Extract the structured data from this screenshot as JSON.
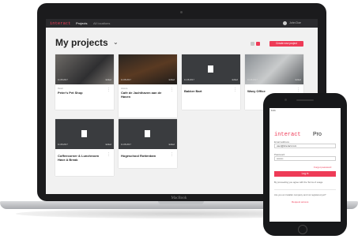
{
  "app": {
    "logo": "interact",
    "nav": [
      "Projects",
      "All locations"
    ],
    "user": "John Doe"
  },
  "page": {
    "title": "My projects",
    "create_button": "Create new project"
  },
  "projects": [
    {
      "name": "Peter's Pet Shop",
      "type": "Retail",
      "badge": "",
      "date": "11.08.2017",
      "edit": "Edited",
      "stats": "",
      "thumb": "photo"
    },
    {
      "name": "Café de Jachthaven aan de Haven",
      "type": "Horeca",
      "badge": "",
      "date": "11.08.2017",
      "edit": "Edited",
      "stats": "",
      "thumb": "photo"
    },
    {
      "name": "Bakker Bart",
      "type": "",
      "badge": "",
      "date": "11.08.2017",
      "edit": "Edited",
      "stats": "",
      "thumb": "doc"
    },
    {
      "name": "Wavy Office",
      "type": "",
      "badge": "",
      "date": "11.08.2017",
      "edit": "Edited",
      "stats": "",
      "thumb": "photo"
    },
    {
      "name": "Coffeecorner & Lunchroom Have A Break",
      "type": "",
      "badge": "",
      "date": "11.08.2017",
      "edit": "Edited",
      "stats": "",
      "thumb": "doc"
    },
    {
      "name": "Hogeschool Rotterdam",
      "type": "",
      "badge": "",
      "date": "11.08.2017",
      "edit": "Edited",
      "stats": "",
      "thumb": "doc"
    }
  ],
  "laptop": {
    "brand": "MacBook"
  },
  "phone": {
    "status": "9:41",
    "logo": "interact",
    "pro": "Pro",
    "email_label": "Email address",
    "email_value": "user@interact.com",
    "password_label": "Password",
    "password_value": "••••••••",
    "forgot": "Forgot password",
    "login": "Log in",
    "terms": "By proceeding you agree with the Terms of usage",
    "company_question": "Are you an installer company and not registered yet?",
    "request_access": "Request access"
  },
  "colors": {
    "accent": "#ee3b57",
    "topbar": "#2a2a2d",
    "dark": "#1b1b1d"
  }
}
